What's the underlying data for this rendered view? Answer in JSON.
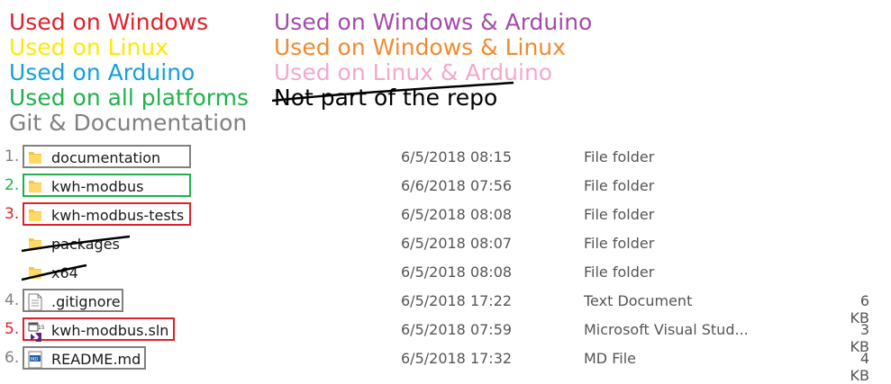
{
  "legend": {
    "items_left": [
      {
        "text": "Used on Windows",
        "color": "#e0202a"
      },
      {
        "text": "Used on Linux",
        "color": "#ffe800"
      },
      {
        "text": "Used on Arduino",
        "color": "#14a0dc"
      },
      {
        "text": "Used on all platforms",
        "color": "#1fb24a"
      },
      {
        "text": "Git & Documentation",
        "color": "#808080"
      }
    ],
    "items_right": [
      {
        "text": "Used on Windows & Arduino",
        "color": "#a44ba8"
      },
      {
        "text": "Used on Windows & Linux",
        "color": "#f28a2e"
      },
      {
        "text": "Used on Linux & Arduino",
        "color": "#f3a8cc"
      },
      {
        "text": "Not part of the repo",
        "color": "#000000"
      }
    ]
  },
  "files": [
    {
      "num": "1.",
      "name": "documentation",
      "date": "6/5/2018 08:15",
      "type": "File folder",
      "size": "",
      "icon": "folder-icon",
      "box_color": "#808080",
      "num_color": "#808080",
      "struck": false
    },
    {
      "num": "2.",
      "name": "kwh-modbus",
      "date": "6/6/2018 07:56",
      "type": "File folder",
      "size": "",
      "icon": "folder-icon",
      "box_color": "#1fb24a",
      "num_color": "#1fb24a",
      "struck": false
    },
    {
      "num": "3.",
      "name": "kwh-modbus-tests",
      "date": "6/5/2018 08:08",
      "type": "File folder",
      "size": "",
      "icon": "folder-icon",
      "box_color": "#e0202a",
      "num_color": "#e0202a",
      "struck": false
    },
    {
      "num": "",
      "name": "packages",
      "date": "6/5/2018 08:07",
      "type": "File folder",
      "size": "",
      "icon": "folder-icon",
      "box_color": "",
      "num_color": "",
      "struck": true
    },
    {
      "num": "",
      "name": "x64",
      "date": "6/5/2018 08:08",
      "type": "File folder",
      "size": "",
      "icon": "folder-icon",
      "box_color": "",
      "num_color": "",
      "struck": true
    },
    {
      "num": "4.",
      "name": ".gitignore",
      "date": "6/5/2018 17:22",
      "type": "Text Document",
      "size": "6 KB",
      "icon": "text-document-icon",
      "box_color": "#808080",
      "num_color": "#808080",
      "struck": false
    },
    {
      "num": "5.",
      "name": "kwh-modbus.sln",
      "date": "6/5/2018 07:59",
      "type": "Microsoft Visual Stud...",
      "size": "3 KB",
      "icon": "visual-studio-solution-icon",
      "box_color": "#e0202a",
      "num_color": "#e0202a",
      "struck": false
    },
    {
      "num": "6.",
      "name": "README.md",
      "date": "6/5/2018 17:32",
      "type": "MD File",
      "size": "4 KB",
      "icon": "markdown-file-icon",
      "box_color": "#808080",
      "num_color": "#808080",
      "struck": false
    }
  ]
}
